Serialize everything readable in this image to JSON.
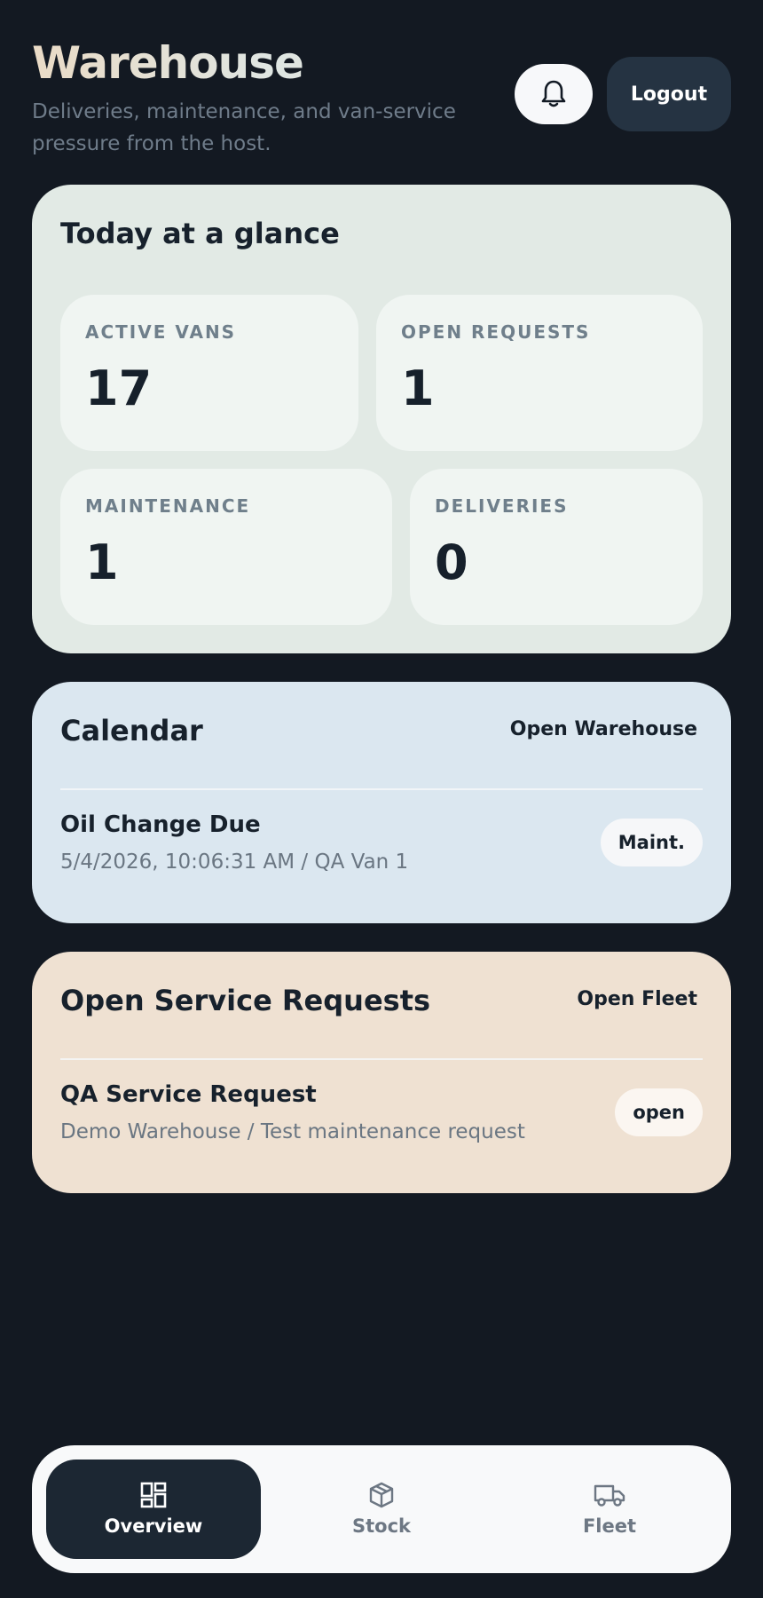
{
  "header": {
    "title": "Warehouse",
    "subtitle": "Deliveries, maintenance, and van-service pressure from the host.",
    "logout_label": "Logout"
  },
  "glance": {
    "title": "Today at a glance",
    "stats": [
      {
        "label": "ACTIVE VANS",
        "value": "17"
      },
      {
        "label": "OPEN REQUESTS",
        "value": "1"
      },
      {
        "label": "MAINTENANCE",
        "value": "1"
      },
      {
        "label": "DELIVERIES",
        "value": "0"
      }
    ]
  },
  "calendar": {
    "title": "Calendar",
    "link": "Open Warehouse",
    "item_title": "Oil Change Due",
    "item_sub": "5/4/2026, 10:06:31 AM / QA Van 1",
    "badge": "Maint."
  },
  "requests": {
    "title": "Open Service Requests",
    "link": "Open Fleet",
    "item_title": "QA Service Request",
    "item_sub": "Demo Warehouse / Test maintenance request",
    "badge": "open"
  },
  "nav": {
    "items": [
      {
        "label": "Overview",
        "icon": "dashboard-icon",
        "active": true
      },
      {
        "label": "Stock",
        "icon": "box-icon",
        "active": false
      },
      {
        "label": "Fleet",
        "icon": "truck-icon",
        "active": false
      }
    ]
  },
  "colors": {
    "background": "#131922",
    "glance_card": "#e2eae5",
    "calendar_card": "#dbe7f0",
    "requests_card": "#efe1d2",
    "nav_active": "#1c2733"
  }
}
